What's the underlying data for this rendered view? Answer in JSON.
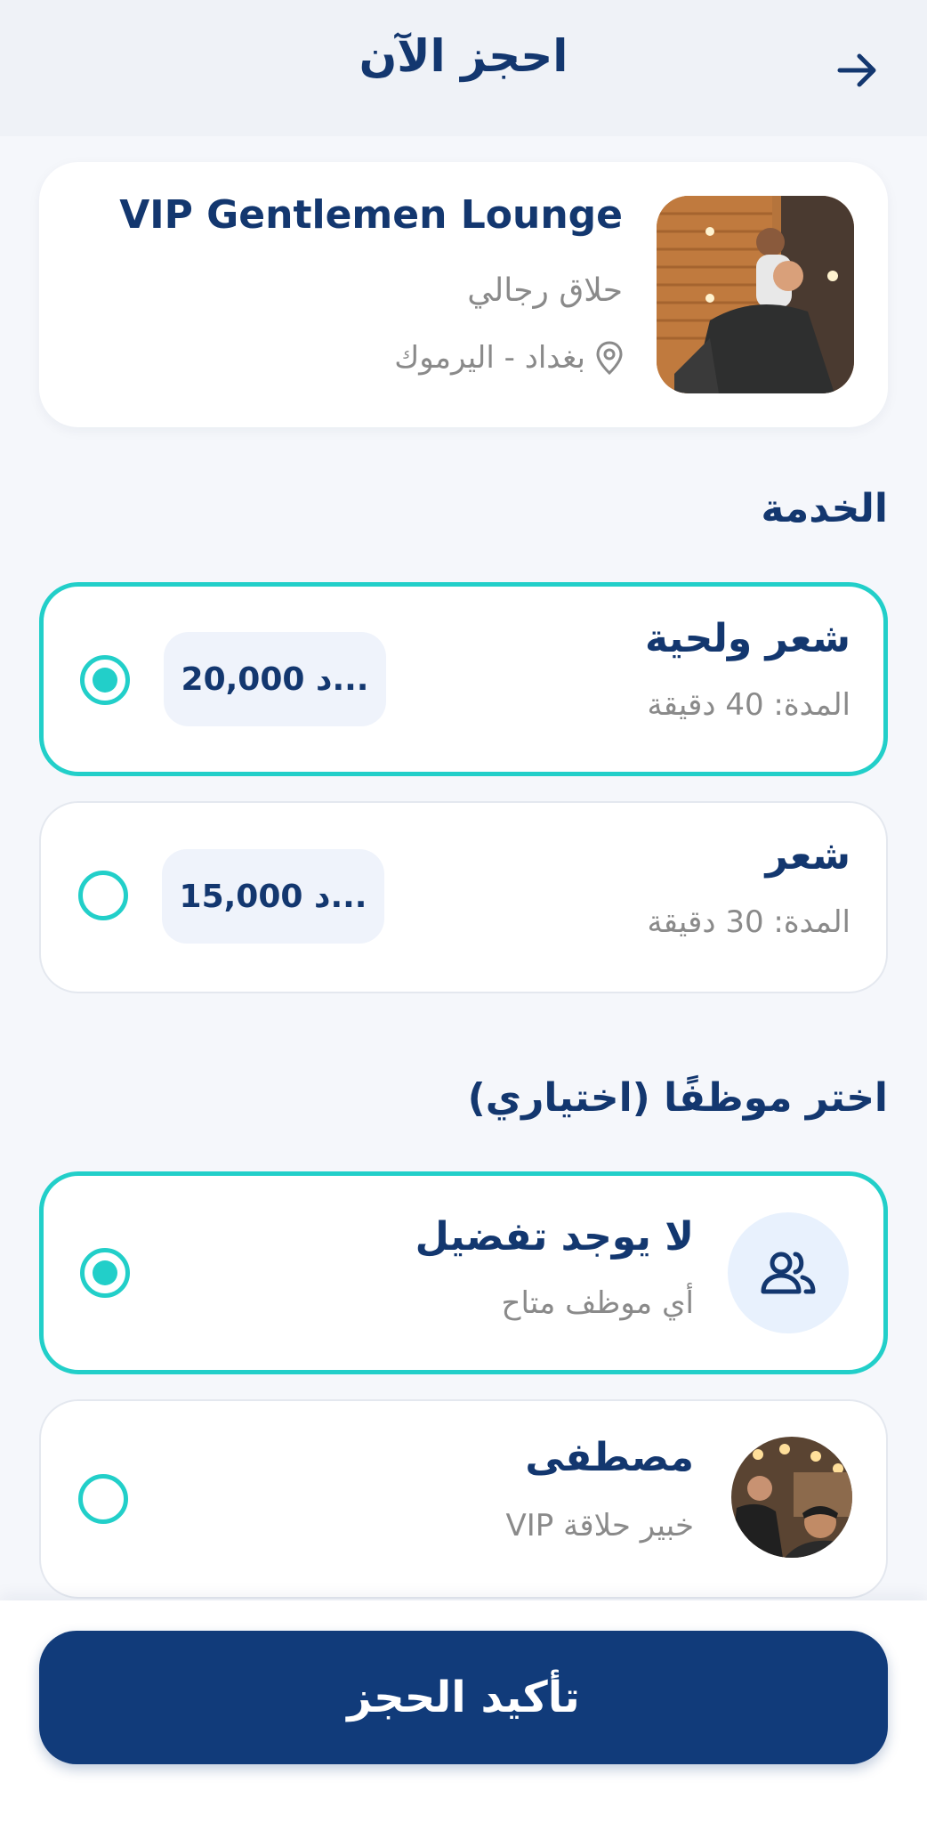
{
  "header": {
    "title": "احجز الآن",
    "back_icon": "arrow-right-icon"
  },
  "salon": {
    "name": "VIP Gentlemen Lounge",
    "type": "حلاق رجالي",
    "location": "بغداد - اليرموك",
    "location_icon": "map-pin-icon"
  },
  "services": {
    "title": "الخدمة",
    "items": [
      {
        "name": "شعر ولحية",
        "duration": "المدة: 40 دقيقة",
        "price": "20,000 د...",
        "selected": true
      },
      {
        "name": "شعر",
        "duration": "المدة: 30 دقيقة",
        "price": "15,000 د...",
        "selected": false
      }
    ]
  },
  "staff": {
    "title": "اختر موظفًا (اختياري)",
    "items": [
      {
        "name": "لا يوجد تفضيل",
        "subtitle": "أي موظف متاح",
        "icon": "users-icon",
        "selected": true
      },
      {
        "name": "مصطفى",
        "subtitle": "خبير حلاقة VIP",
        "selected": false
      }
    ]
  },
  "footer": {
    "confirm_label": "تأكيد الحجز"
  },
  "colors": {
    "primary": "#13376f",
    "accent": "#22cfc9",
    "button": "#113b7a",
    "muted_text": "#8a8a8a"
  }
}
